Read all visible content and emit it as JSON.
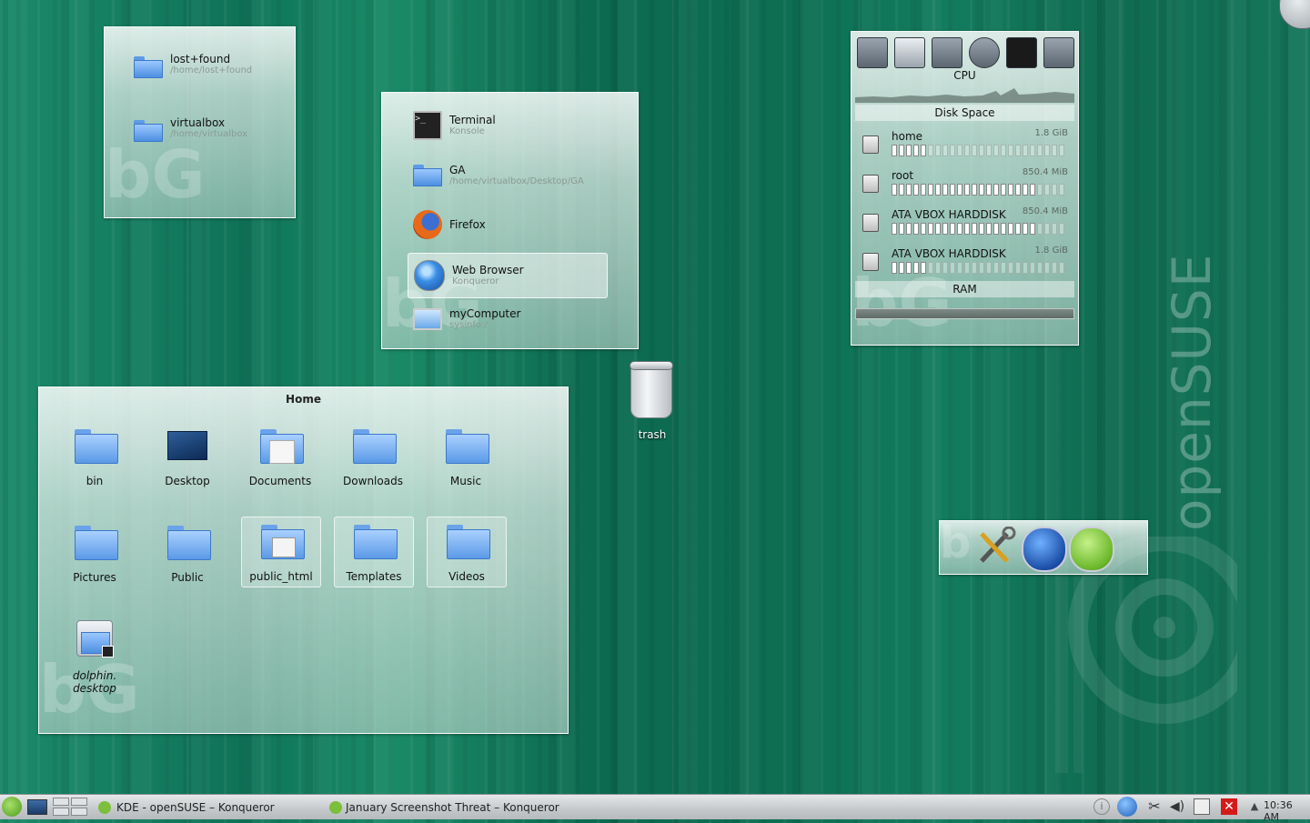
{
  "favorites": {
    "items": [
      {
        "name": "lost+found",
        "path": "/home/lost+found"
      },
      {
        "name": "virtualbox",
        "path": "/home/virtualbox"
      }
    ]
  },
  "launcher": {
    "items": [
      {
        "name": "Terminal",
        "sub": "Konsole",
        "icon": "terminal-icon"
      },
      {
        "name": "GA",
        "sub": "/home/virtualbox/Desktop/GA",
        "icon": "folder-icon"
      },
      {
        "name": "Firefox",
        "sub": "",
        "icon": "firefox-icon"
      },
      {
        "name": "Web Browser",
        "sub": "Konqueror",
        "icon": "konqueror-globe-icon"
      },
      {
        "name": "myComputer",
        "sub": "sysinfo:/",
        "icon": "computer-icon"
      }
    ]
  },
  "home": {
    "title": "Home",
    "items": [
      {
        "label": "bin",
        "icon": "folder-icon"
      },
      {
        "label": "Desktop",
        "icon": "desktop-folder-icon"
      },
      {
        "label": "Documents",
        "icon": "documents-folder-icon"
      },
      {
        "label": "Downloads",
        "icon": "folder-icon"
      },
      {
        "label": "Music",
        "icon": "folder-icon"
      },
      {
        "label": "Pictures",
        "icon": "folder-icon"
      },
      {
        "label": "Public",
        "icon": "folder-icon"
      },
      {
        "label": "public_html",
        "icon": "html-folder-icon"
      },
      {
        "label": "Templates",
        "icon": "folder-icon"
      },
      {
        "label": "Videos",
        "icon": "folder-icon"
      },
      {
        "label": "dolphin.\ndesktop",
        "icon": "dolphin-cabinet-icon"
      }
    ],
    "dolphin_line1": "dolphin.",
    "dolphin_line2": "desktop"
  },
  "trash": {
    "label": "trash"
  },
  "sysmon": {
    "cpu_label": "CPU",
    "disk_label": "Disk Space",
    "ram_label": "RAM",
    "disks": [
      {
        "name": "home",
        "size": "1.8 GiB",
        "fill": 0.2
      },
      {
        "name": "root",
        "size": "850.4 MiB",
        "fill": 0.83
      },
      {
        "name": "ATA VBOX HARDDISK",
        "size": "850.4 MiB",
        "fill": 0.83
      },
      {
        "name": "ATA VBOX HARDDISK",
        "size": "1.8 GiB",
        "fill": 0.2
      }
    ]
  },
  "quicklaunch": {
    "items": [
      "tools-icon",
      "konqueror-wolf-icon",
      "amarok-icon"
    ]
  },
  "wallpaper_brand": "openSUSE",
  "taskbar": {
    "tasks": [
      {
        "label": "KDE - openSUSE – Konqueror"
      },
      {
        "label": "January Screenshot Threat – Konqueror"
      }
    ],
    "clock": "10:36 AM"
  },
  "colors": {
    "accent": "#0f7358",
    "folder": "#5b9ae6"
  }
}
